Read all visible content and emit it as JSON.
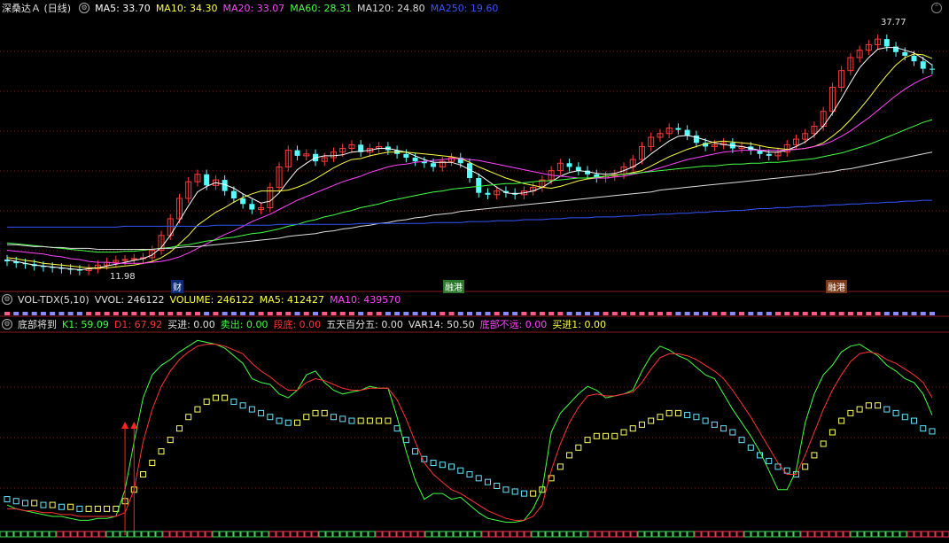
{
  "header": {
    "stock_title": "深桑达Ａ (日线)",
    "ma_items": [
      {
        "label": "MA5: 33.70",
        "color": "#ffffff"
      },
      {
        "label": "MA10: 34.30",
        "color": "#ffff44"
      },
      {
        "label": "MA20: 33.07",
        "color": "#ff44ff"
      },
      {
        "label": "MA60: 28.31",
        "color": "#44ff44"
      },
      {
        "label": "MA120: 24.80",
        "color": "#dddddd"
      },
      {
        "label": "MA250: 19.60",
        "color": "#3355ff"
      }
    ],
    "max_price_label": "37.77",
    "min_price_label": "11.98",
    "event_tags": [
      "财",
      "融港",
      "融港"
    ]
  },
  "volume_panel": {
    "indicator_name": "VOL-TDX(5,10)",
    "items": [
      {
        "label": "VVOL: 246122",
        "color": "#e0e0e0"
      },
      {
        "label": "VOLUME: 246122",
        "color": "#ffff44"
      },
      {
        "label": "MA5: 412427",
        "color": "#ffff44"
      },
      {
        "label": "MA10: 439570",
        "color": "#ff44ff"
      }
    ]
  },
  "indicator_panel": {
    "indicator_name": "底部将到",
    "items": [
      {
        "label": "K1: 59.09",
        "color": "#44ff44"
      },
      {
        "label": "D1: 67.92",
        "color": "#ff3333"
      },
      {
        "label": "买进: 0.00",
        "color": "#e0e0e0"
      },
      {
        "label": "卖出: 0.00",
        "color": "#44ff44"
      },
      {
        "label": "段底: 0.00",
        "color": "#ff3333"
      },
      {
        "label": "五天百分五: 0.00",
        "color": "#e0e0e0"
      },
      {
        "label": "VAR14: 50.50",
        "color": "#e0e0e0"
      },
      {
        "label": "底部不远: 0.00",
        "color": "#ff44ff"
      },
      {
        "label": "买进1: 0.00",
        "color": "#ffff44"
      }
    ]
  },
  "chart_data": {
    "type": "line",
    "xlabel": "",
    "ylabel": "",
    "price_range": [
      11.0,
      39.5
    ],
    "close": [
      13.0,
      12.8,
      12.7,
      12.5,
      12.4,
      12.3,
      12.2,
      12.1,
      12.0,
      12.2,
      12.6,
      12.9,
      13.1,
      13.2,
      13.3,
      13.4,
      14.2,
      15.8,
      17.6,
      19.8,
      21.6,
      22.4,
      21.2,
      21.8,
      20.6,
      19.8,
      19.2,
      18.6,
      18.8,
      21.0,
      23.2,
      25.0,
      24.4,
      24.6,
      23.8,
      24.2,
      24.8,
      25.2,
      25.6,
      24.8,
      25.2,
      25.4,
      25.0,
      24.6,
      24.2,
      23.8,
      23.6,
      23.2,
      23.8,
      24.2,
      23.6,
      22.0,
      20.4,
      20.2,
      20.6,
      20.4,
      20.2,
      20.6,
      21.0,
      21.8,
      22.8,
      23.6,
      23.2,
      22.8,
      22.4,
      22.0,
      22.2,
      22.4,
      23.2,
      24.0,
      25.4,
      26.4,
      26.8,
      27.4,
      27.2,
      26.6,
      25.8,
      25.4,
      25.6,
      25.8,
      25.2,
      25.4,
      25.0,
      24.6,
      24.4,
      24.8,
      25.6,
      26.2,
      26.8,
      27.6,
      29.2,
      31.8,
      33.6,
      35.0,
      35.8,
      36.4,
      37.0,
      36.2,
      35.6,
      35.2,
      34.6,
      33.8,
      33.7
    ],
    "series": [
      {
        "name": "MA5",
        "values": [
          13.2,
          13.0,
          12.8,
          12.6,
          12.5,
          12.4,
          12.3,
          12.2,
          12.1,
          12.2,
          12.3,
          12.5,
          12.7,
          12.9,
          13.1,
          13.3,
          13.7,
          14.5,
          15.8,
          17.4,
          19.0,
          20.5,
          21.1,
          21.5,
          21.3,
          20.9,
          20.3,
          19.8,
          19.3,
          19.5,
          20.4,
          21.7,
          22.9,
          23.6,
          24.2,
          24.4,
          24.4,
          24.5,
          24.8,
          24.9,
          25.0,
          25.2,
          25.2,
          25.0,
          24.8,
          24.4,
          24.0,
          23.7,
          23.7,
          23.7,
          23.4,
          22.9,
          22.4,
          21.7,
          21.0,
          20.4,
          20.3,
          20.4,
          20.6,
          21.0,
          21.6,
          22.2,
          22.6,
          22.8,
          22.7,
          22.5,
          22.4,
          22.5,
          22.8,
          23.2,
          23.8,
          24.6,
          25.3,
          26.0,
          26.5,
          26.6,
          26.4,
          26.1,
          25.8,
          25.6,
          25.5,
          25.4,
          25.2,
          25.0,
          24.8,
          24.8,
          25.0,
          25.4,
          25.9,
          26.6,
          27.6,
          29.0,
          30.6,
          32.3,
          33.9,
          35.0,
          35.9,
          36.1,
          36.1,
          35.8,
          35.5,
          34.9,
          34.2
        ]
      },
      {
        "name": "MA10",
        "values": [
          13.4,
          13.3,
          13.1,
          13.0,
          12.8,
          12.7,
          12.6,
          12.5,
          12.4,
          12.3,
          12.3,
          12.3,
          12.4,
          12.5,
          12.6,
          12.8,
          13.0,
          13.4,
          14.0,
          14.9,
          15.8,
          16.9,
          17.6,
          18.3,
          18.8,
          19.4,
          19.9,
          20.3,
          20.6,
          20.6,
          20.6,
          20.7,
          21.0,
          21.4,
          21.9,
          22.5,
          23.1,
          23.6,
          24.0,
          24.1,
          24.4,
          24.6,
          24.8,
          24.8,
          24.8,
          24.7,
          24.6,
          24.5,
          24.4,
          24.3,
          24.1,
          23.7,
          23.2,
          22.8,
          22.4,
          22.0,
          21.7,
          21.4,
          21.2,
          21.0,
          20.9,
          21.1,
          21.4,
          21.7,
          21.9,
          22.0,
          22.2,
          22.3,
          22.4,
          22.6,
          22.8,
          23.3,
          23.8,
          24.3,
          24.7,
          25.1,
          25.4,
          25.7,
          25.9,
          26.0,
          25.9,
          25.8,
          25.7,
          25.5,
          25.3,
          25.2,
          25.1,
          25.1,
          25.2,
          25.4,
          25.8,
          26.5,
          27.3,
          28.3,
          29.4,
          30.6,
          31.9,
          33.1,
          34.2,
          35.0,
          35.4,
          35.3,
          34.9
        ]
      },
      {
        "name": "MA20",
        "values": [
          14.2,
          14.1,
          14.0,
          13.9,
          13.8,
          13.6,
          13.5,
          13.3,
          13.2,
          13.0,
          12.9,
          12.9,
          12.8,
          12.8,
          12.8,
          12.8,
          12.9,
          13.0,
          13.2,
          13.5,
          13.9,
          14.4,
          14.9,
          15.4,
          15.9,
          16.3,
          16.8,
          17.3,
          17.7,
          18.1,
          18.6,
          19.1,
          19.6,
          20.0,
          20.4,
          20.8,
          21.2,
          21.6,
          21.9,
          22.2,
          22.6,
          22.9,
          23.2,
          23.4,
          23.5,
          23.7,
          23.8,
          23.9,
          24.0,
          24.1,
          24.1,
          24.0,
          23.9,
          23.7,
          23.5,
          23.3,
          23.1,
          22.9,
          22.7,
          22.5,
          22.3,
          22.2,
          22.1,
          22.0,
          22.0,
          22.0,
          22.0,
          22.1,
          22.2,
          22.4,
          22.6,
          22.8,
          23.1,
          23.4,
          23.7,
          24.0,
          24.2,
          24.4,
          24.6,
          24.8,
          24.9,
          25.0,
          25.0,
          25.0,
          25.0,
          25.0,
          25.0,
          25.1,
          25.2,
          25.4,
          25.6,
          26.0,
          26.5,
          27.1,
          27.8,
          28.5,
          29.3,
          30.1,
          30.9,
          31.6,
          32.2,
          32.7,
          33.1
        ]
      },
      {
        "name": "MA60",
        "values": [
          15.0,
          14.9,
          14.8,
          14.7,
          14.6,
          14.5,
          14.4,
          14.3,
          14.2,
          14.1,
          14.0,
          14.0,
          14.0,
          14.1,
          14.1,
          14.2,
          14.3,
          14.4,
          14.5,
          14.7,
          14.8,
          15.0,
          15.2,
          15.3,
          15.5,
          15.6,
          15.8,
          16.0,
          16.1,
          16.3,
          16.5,
          16.8,
          17.0,
          17.3,
          17.5,
          17.8,
          18.0,
          18.3,
          18.5,
          18.8,
          19.0,
          19.2,
          19.5,
          19.7,
          19.9,
          20.1,
          20.3,
          20.5,
          20.6,
          20.8,
          20.9,
          21.0,
          21.1,
          21.2,
          21.3,
          21.4,
          21.4,
          21.5,
          21.6,
          21.7,
          21.7,
          21.8,
          21.9,
          22.0,
          22.0,
          22.1,
          22.2,
          22.3,
          22.4,
          22.5,
          22.6,
          22.7,
          22.8,
          22.9,
          23.0,
          23.1,
          23.2,
          23.3,
          23.3,
          23.4,
          23.5,
          23.5,
          23.6,
          23.6,
          23.7,
          23.7,
          23.8,
          23.9,
          24.0,
          24.1,
          24.3,
          24.5,
          24.7,
          25.0,
          25.3,
          25.6,
          26.0,
          26.4,
          26.8,
          27.2,
          27.6,
          28.0,
          28.3
        ]
      },
      {
        "name": "MA120",
        "values": [
          14.8,
          14.8,
          14.7,
          14.6,
          14.6,
          14.5,
          14.5,
          14.4,
          14.4,
          14.4,
          14.3,
          14.3,
          14.3,
          14.3,
          14.3,
          14.3,
          14.3,
          14.4,
          14.4,
          14.5,
          14.6,
          14.6,
          14.7,
          14.8,
          14.9,
          15.0,
          15.1,
          15.2,
          15.3,
          15.4,
          15.5,
          15.7,
          15.8,
          15.9,
          16.0,
          16.2,
          16.3,
          16.5,
          16.6,
          16.8,
          16.9,
          17.1,
          17.2,
          17.4,
          17.5,
          17.7,
          17.8,
          18.0,
          18.1,
          18.2,
          18.4,
          18.5,
          18.6,
          18.7,
          18.8,
          18.9,
          19.0,
          19.1,
          19.2,
          19.3,
          19.4,
          19.5,
          19.6,
          19.7,
          19.8,
          19.9,
          20.0,
          20.1,
          20.2,
          20.3,
          20.4,
          20.5,
          20.7,
          20.8,
          20.9,
          21.0,
          21.1,
          21.2,
          21.3,
          21.4,
          21.5,
          21.6,
          21.7,
          21.8,
          21.9,
          22.0,
          22.1,
          22.2,
          22.3,
          22.4,
          22.6,
          22.7,
          22.9,
          23.0,
          23.2,
          23.4,
          23.6,
          23.8,
          24.0,
          24.2,
          24.4,
          24.6,
          24.8
        ]
      },
      {
        "name": "MA250",
        "values": [
          16.7,
          16.7,
          16.7,
          16.7,
          16.7,
          16.7,
          16.7,
          16.7,
          16.7,
          16.7,
          16.7,
          16.7,
          16.7,
          16.8,
          16.8,
          16.8,
          16.8,
          16.8,
          16.8,
          16.8,
          16.8,
          16.8,
          16.8,
          16.9,
          16.9,
          16.9,
          16.9,
          16.9,
          16.9,
          16.9,
          17.0,
          17.0,
          17.0,
          17.0,
          17.0,
          17.0,
          17.0,
          17.0,
          17.0,
          17.1,
          17.1,
          17.1,
          17.1,
          17.1,
          17.1,
          17.1,
          17.1,
          17.2,
          17.2,
          17.2,
          17.2,
          17.3,
          17.3,
          17.3,
          17.4,
          17.4,
          17.4,
          17.5,
          17.5,
          17.5,
          17.6,
          17.6,
          17.7,
          17.7,
          17.7,
          17.8,
          17.8,
          17.8,
          17.9,
          17.9,
          18.0,
          18.0,
          18.1,
          18.1,
          18.2,
          18.2,
          18.3,
          18.3,
          18.4,
          18.4,
          18.5,
          18.5,
          18.6,
          18.7,
          18.7,
          18.8,
          18.8,
          18.9,
          18.9,
          19.0,
          19.0,
          19.1,
          19.1,
          19.2,
          19.2,
          19.3,
          19.3,
          19.4,
          19.4,
          19.5,
          19.5,
          19.6,
          19.6
        ]
      },
      {
        "name": "K1",
        "values": [
          12,
          10,
          9,
          8,
          7,
          6,
          6,
          5,
          4,
          4,
          5,
          5,
          6,
          20,
          45,
          68,
          80,
          85,
          88,
          92,
          95,
          98,
          97,
          96,
          94,
          90,
          86,
          78,
          76,
          75,
          70,
          68,
          72,
          80,
          82,
          76,
          72,
          70,
          71,
          72,
          74,
          73,
          73,
          58,
          40,
          25,
          15,
          18,
          18,
          15,
          16,
          12,
          8,
          5,
          4,
          3,
          3,
          4,
          10,
          20,
          50,
          60,
          65,
          70,
          74,
          72,
          68,
          69,
          70,
          72,
          82,
          90,
          95,
          93,
          90,
          88,
          84,
          80,
          78,
          70,
          62,
          55,
          48,
          40,
          30,
          20,
          20,
          30,
          55,
          70,
          80,
          85,
          92,
          95,
          96,
          93,
          90,
          85,
          82,
          78,
          76,
          70,
          59
        ]
      },
      {
        "name": "D1",
        "values": [
          10,
          10,
          9,
          9,
          8,
          8,
          7,
          7,
          6,
          6,
          6,
          6,
          6,
          8,
          20,
          45,
          62,
          74,
          82,
          88,
          92,
          95,
          96,
          96,
          95,
          93,
          91,
          86,
          82,
          79,
          75,
          72,
          72,
          76,
          78,
          77,
          75,
          73,
          72,
          72,
          73,
          73,
          73,
          67,
          57,
          45,
          34,
          28,
          24,
          20,
          18,
          15,
          12,
          9,
          7,
          5,
          4,
          4,
          6,
          12,
          30,
          44,
          55,
          63,
          69,
          70,
          69,
          69,
          70,
          71,
          76,
          83,
          89,
          91,
          91,
          90,
          88,
          85,
          82,
          78,
          72,
          65,
          58,
          50,
          42,
          34,
          28,
          28,
          38,
          50,
          62,
          72,
          80,
          87,
          91,
          92,
          91,
          88,
          86,
          83,
          80,
          76,
          68
        ]
      },
      {
        "name": "VAR14",
        "values": [
          15,
          14,
          13,
          13,
          12,
          12,
          11,
          11,
          10,
          10,
          10,
          10,
          10,
          14,
          20,
          28,
          34,
          40,
          46,
          52,
          58,
          62,
          66,
          68,
          68,
          66,
          64,
          62,
          60,
          58,
          56,
          55,
          55,
          58,
          60,
          60,
          58,
          57,
          56,
          56,
          56,
          56,
          56,
          52,
          46,
          40,
          36,
          34,
          33,
          32,
          30,
          28,
          26,
          24,
          22,
          20,
          19,
          18,
          18,
          20,
          26,
          32,
          38,
          42,
          46,
          48,
          48,
          48,
          50,
          52,
          54,
          56,
          58,
          60,
          60,
          59,
          58,
          56,
          54,
          52,
          50,
          46,
          42,
          38,
          35,
          32,
          30,
          28,
          32,
          38,
          44,
          50,
          56,
          60,
          62,
          64,
          64,
          62,
          60,
          58,
          56,
          52,
          50.5
        ]
      }
    ]
  }
}
